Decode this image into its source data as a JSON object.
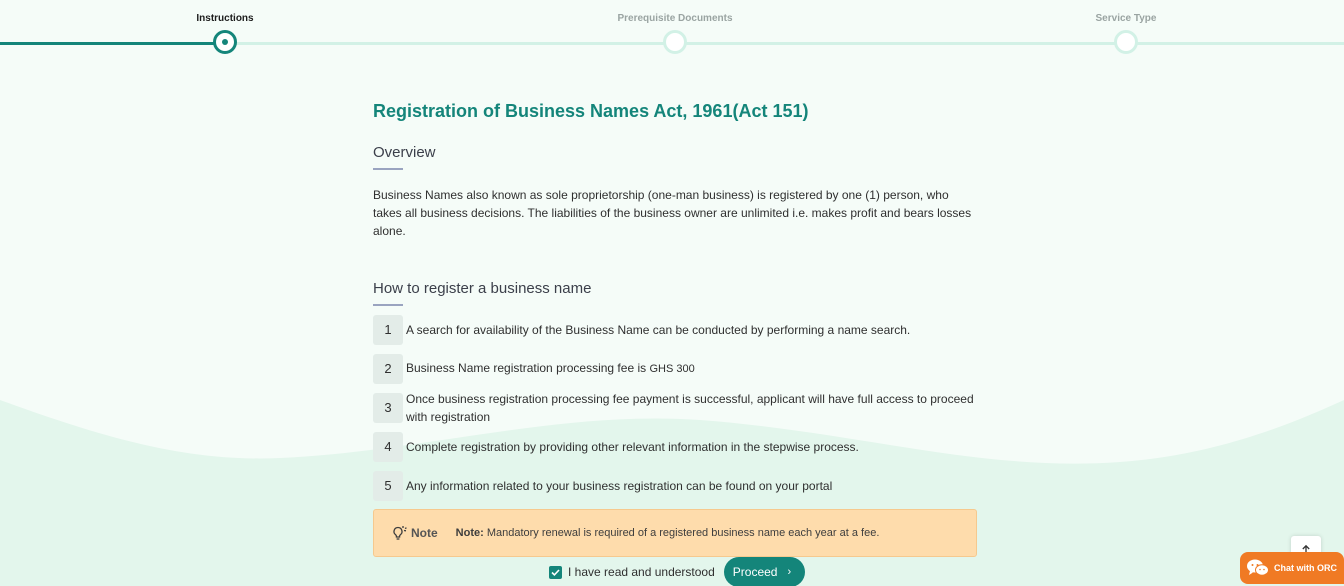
{
  "stepper": {
    "steps": [
      {
        "label": "Instructions",
        "state": "active"
      },
      {
        "label": "Prerequisite Documents",
        "state": "pending"
      },
      {
        "label": "Service Type",
        "state": "pending"
      }
    ]
  },
  "main": {
    "title": "Registration of Business Names Act, 1961(Act 151)",
    "overview": {
      "heading": "Overview",
      "text": "Business Names also known as sole proprietorship (one-man business) is registered by one (1) person, who takes all business decisions. The liabilities of the business owner are unlimited i.e. makes profit and bears losses alone."
    },
    "howto": {
      "heading": "How to register a business name",
      "steps": [
        {
          "num": "1",
          "text": "A search for availability of the Business Name can be conducted by performing a name search."
        },
        {
          "num": "2",
          "text": "Business Name registration processing fee is ",
          "fee": "GHS 300"
        },
        {
          "num": "3",
          "text": "Once business registration processing fee payment is successful, applicant will have full access to proceed with registration"
        },
        {
          "num": "4",
          "text": "Complete registration by providing other relevant information in the stepwise process."
        },
        {
          "num": "5",
          "text": "Any information related to your business registration can be found on your portal"
        }
      ]
    },
    "note": {
      "label": "Note",
      "prefix": "Note:",
      "text": " Mandatory renewal is required of a registered business name each year at a fee."
    }
  },
  "actions": {
    "checkbox_label": "I have read and understood",
    "checkbox_checked": true,
    "proceed_label": "Proceed"
  },
  "chat": {
    "label": "Chat with ORC"
  },
  "icons": {
    "note": "lightbulb-icon",
    "scroll_top": "arrow-up-icon",
    "chat": "wechat-icon",
    "proceed": "chevron-right-icon"
  },
  "colors": {
    "accent": "#14857a",
    "note_bg": "#fedcac",
    "chat": "#f07a24"
  }
}
